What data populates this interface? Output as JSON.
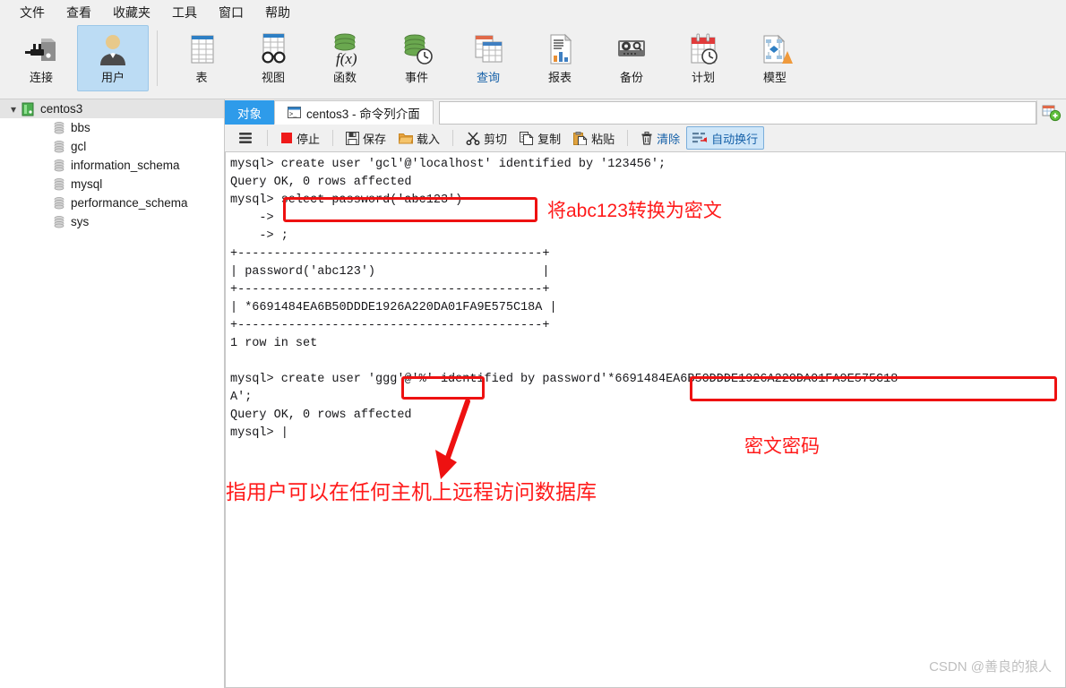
{
  "menu": {
    "items": [
      {
        "label": "文件",
        "name": "menu-file"
      },
      {
        "label": "查看",
        "name": "menu-view"
      },
      {
        "label": "收藏夹",
        "name": "menu-favorites"
      },
      {
        "label": "工具",
        "name": "menu-tools"
      },
      {
        "label": "窗口",
        "name": "menu-window"
      },
      {
        "label": "帮助",
        "name": "menu-help"
      }
    ]
  },
  "ribbon": {
    "buttons": [
      {
        "label": "连接",
        "icon": "connection-icon",
        "active": false,
        "blue": false
      },
      {
        "label": "用户",
        "icon": "user-icon",
        "active": true,
        "blue": false
      },
      {
        "label": "表",
        "icon": "table-icon",
        "active": false,
        "blue": false
      },
      {
        "label": "视图",
        "icon": "view-icon",
        "active": false,
        "blue": false
      },
      {
        "label": "函数",
        "icon": "function-icon",
        "active": false,
        "blue": false
      },
      {
        "label": "事件",
        "icon": "event-icon",
        "active": false,
        "blue": false
      },
      {
        "label": "查询",
        "icon": "query-icon",
        "active": false,
        "blue": true
      },
      {
        "label": "报表",
        "icon": "report-icon",
        "active": false,
        "blue": false
      },
      {
        "label": "备份",
        "icon": "backup-icon",
        "active": false,
        "blue": false
      },
      {
        "label": "计划",
        "icon": "schedule-icon",
        "active": false,
        "blue": false
      },
      {
        "label": "模型",
        "icon": "model-icon",
        "active": false,
        "blue": false
      }
    ]
  },
  "sidebar": {
    "root": {
      "label": "centos3",
      "expanded": true
    },
    "databases": [
      {
        "label": "bbs"
      },
      {
        "label": "gcl"
      },
      {
        "label": "information_schema"
      },
      {
        "label": "mysql"
      },
      {
        "label": "performance_schema"
      },
      {
        "label": "sys"
      }
    ]
  },
  "tabs": {
    "object_tab": "对象",
    "console_tab": "centos3 - 命令列介面",
    "address_value": "",
    "add_button_title": "新建查询"
  },
  "console_toolbar": {
    "menu_label": "",
    "buttons": [
      {
        "label": "停止",
        "icon": "stop-icon",
        "on": false,
        "blue": false
      },
      {
        "label": "保存",
        "icon": "save-icon",
        "on": false,
        "blue": false
      },
      {
        "label": "载入",
        "icon": "folder-open-icon",
        "on": false,
        "blue": false
      },
      {
        "label": "剪切",
        "icon": "scissors-icon",
        "on": false,
        "blue": false
      },
      {
        "label": "复制",
        "icon": "copy-icon",
        "on": false,
        "blue": false
      },
      {
        "label": "粘贴",
        "icon": "paste-icon",
        "on": false,
        "blue": false
      },
      {
        "label": "清除",
        "icon": "trash-icon",
        "on": false,
        "blue": true
      },
      {
        "label": "自动换行",
        "icon": "wrap-text-icon",
        "on": true,
        "blue": true
      }
    ]
  },
  "terminal": {
    "text": "mysql> create user 'gcl'@'localhost' identified by '123456';\nQuery OK, 0 rows affected\nmysql> select password('abc123')\n    ->\n    -> ;\n+------------------------------------------+\n| password('abc123')                       |\n+------------------------------------------+\n| *6691484EA6B50DDDE1926A220DA01FA9E575C18A |\n+------------------------------------------+\n1 row in set\n\nmysql> create user 'ggg'@'%' identified by password'*6691484EA6B50DDDE1926A220DA01FA9E575C18\nA';\nQuery OK, 0 rows affected\nmysql> |"
  },
  "annotations": [
    {
      "name": "annotation-encrypt-abc123",
      "text": "将abc123转换为密文"
    },
    {
      "name": "annotation-cipher-password",
      "text": "密文密码"
    },
    {
      "name": "annotation-any-host",
      "text": "指用户可以在任何主机上远程访问数据库"
    }
  ],
  "watermark": {
    "text": "CSDN @善良的狼人"
  },
  "colors": {
    "accent_blue": "#2e9bea",
    "annotation_red": "#ff1a1a",
    "box_red": "#ee1111",
    "active_ribbon": "#bcdcf4",
    "link_blue": "#1560a8"
  }
}
